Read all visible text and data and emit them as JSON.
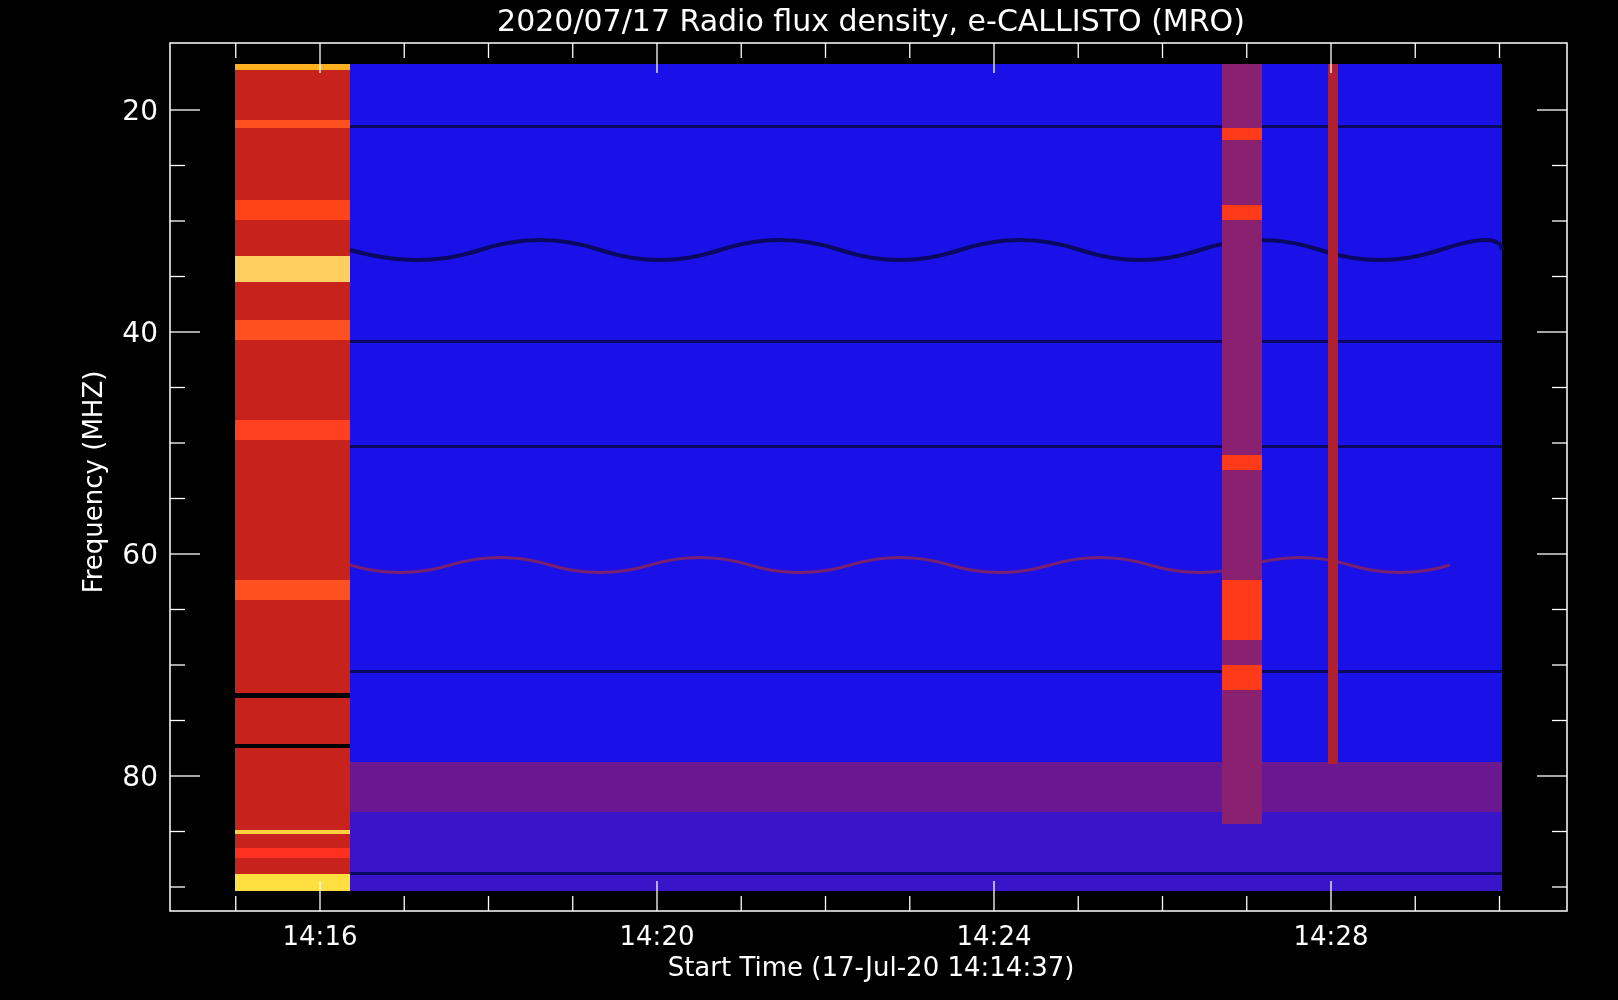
{
  "plot": {
    "title": "2020/07/17  Radio flux density, e-CALLISTO (MRO)",
    "xlabel": "Start Time (17-Jul-20 14:14:37)",
    "ylabel": "Frequency (MHZ)",
    "y_tick_labels": [
      "20",
      "40",
      "60",
      "80"
    ],
    "x_tick_labels": [
      "14:16",
      "14:20",
      "14:24",
      "14:28"
    ]
  }
}
